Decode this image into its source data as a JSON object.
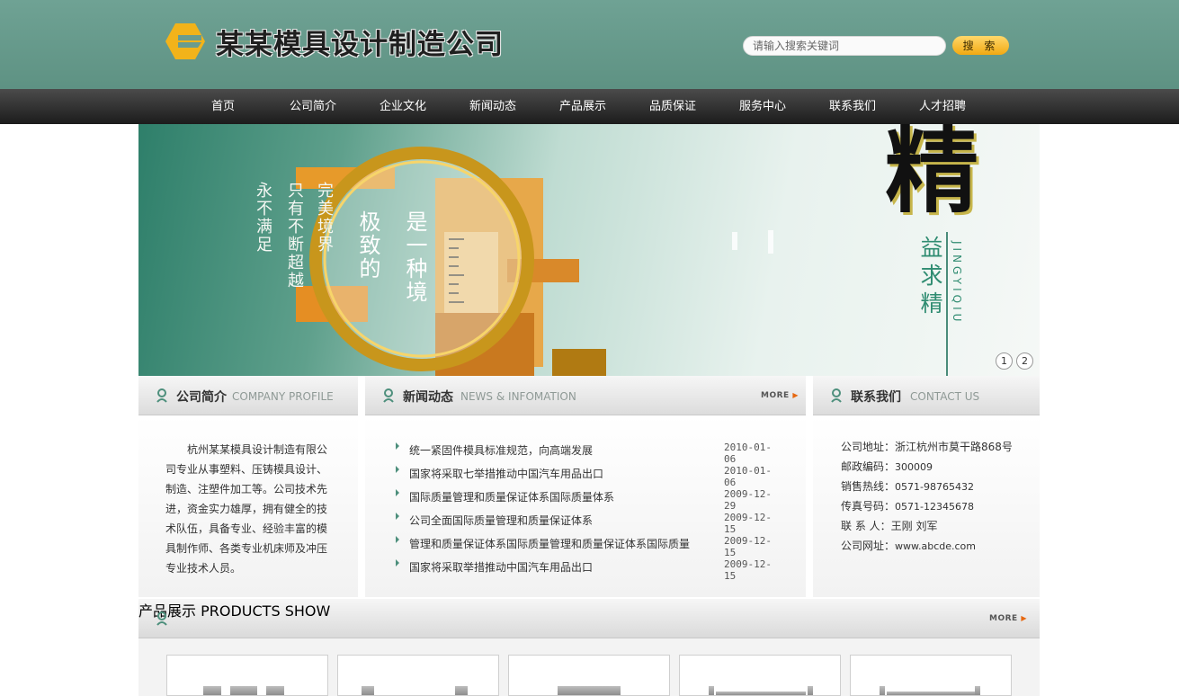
{
  "header": {
    "company_name": "某某模具设计制造公司",
    "search_placeholder": "请输入搜索关键词",
    "search_button": "搜 索",
    "brand_color": "#f2b31a",
    "header_color": "#6a9c8e"
  },
  "nav": {
    "items": [
      "首页",
      "公司简介",
      "企业文化",
      "新闻动态",
      "产品展示",
      "品质保证",
      "服务中心",
      "联系我们",
      "人才招聘"
    ]
  },
  "banner": {
    "col1": "永不满足",
    "col2": "只有不断超越",
    "col3": "完美境界",
    "col4": "极致的",
    "col5": "是一种境",
    "calligraphy": "精",
    "sub": "益求精",
    "pinyin": "JINGYIQIU",
    "slides": [
      "1",
      "2"
    ]
  },
  "profile": {
    "title": "公司简介",
    "title_en": "COMPANY PROFILE",
    "text": "杭州某某模具设计制造有限公司专业从事塑料、压铸模具设计、制造、注塑件加工等。公司技术先进，资金实力雄厚，拥有健全的技术队伍，具备专业、经验丰富的模具制作师、各类专业机床师及冲压专业技术人员。"
  },
  "news": {
    "title": "新闻动态",
    "title_en": "NEWS & INFOMATION",
    "more": "MORE",
    "items": [
      {
        "title": "统一紧固件模具标准规范，向高端发展",
        "date": "2010-01-06"
      },
      {
        "title": "国家将采取七举措推动中国汽车用品出口",
        "date": "2010-01-06"
      },
      {
        "title": "国际质量管理和质量保证体系国际质量体系",
        "date": "2009-12-29"
      },
      {
        "title": "公司全面国际质量管理和质量保证体系",
        "date": "2009-12-15"
      },
      {
        "title": "管理和质量保证体系国际质量管理和质量保证体系国际质量",
        "date": "2009-12-15"
      },
      {
        "title": "国家将采取举措推动中国汽车用品出口",
        "date": "2009-12-15"
      }
    ]
  },
  "contact": {
    "title": "联系我们",
    "title_en": "CONTACT US",
    "items": [
      {
        "label": "公司地址：",
        "value": "浙江杭州市莫干路868号"
      },
      {
        "label": "邮政编码：",
        "value": "300009"
      },
      {
        "label": "销售热线：",
        "value": "0571-98765432"
      },
      {
        "label": "传真号码：",
        "value": "0571-12345678"
      },
      {
        "label": "联 系 人：",
        "value": "王刚 刘军"
      },
      {
        "label": "公司网址：",
        "value": "www.abcde.com"
      }
    ]
  },
  "products": {
    "title": "产品展示",
    "title_en": "PRODUCTS SHOW",
    "more": "MORE"
  }
}
